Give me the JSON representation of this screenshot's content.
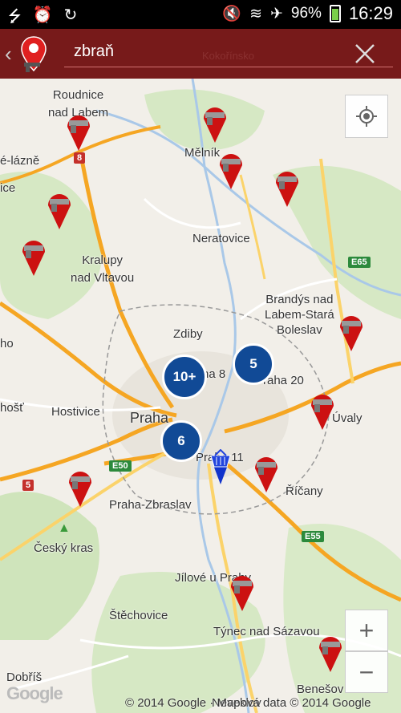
{
  "status_bar": {
    "icons_left": [
      "usb-icon",
      "alarm-icon",
      "sync-icon"
    ],
    "icons_right": [
      "mute-icon",
      "wifi-icon",
      "airplane-icon",
      "battery-icon"
    ],
    "battery": "96%",
    "time": "16:29"
  },
  "app_bar": {
    "search_value": "zbraň",
    "back_glyph": "‹",
    "logo_icon": "map-pin-gun-logo"
  },
  "map": {
    "places": {
      "roudnice": "Roudnice\nnad Labem",
      "melnik": "Mělník",
      "kokorinsko": "Kokořínsko",
      "lazne": "é-lázně",
      "ice": "ice",
      "neratovice": "Neratovice",
      "kralupy": "Kralupy\nnad Vltavou",
      "brandys": "Brandýs nad\nLabem-Stará\nBoleslav",
      "zdiby": "Zdiby",
      "ho": "ho",
      "praha8": "ha 8",
      "praha20": "Praha 20",
      "hostivice": "Hostivice",
      "host": "hošť",
      "praha": "Praha",
      "uvaly": "Úvaly",
      "praha11": "Praha 11",
      "ricany": "Říčany",
      "zbraslav": "Praha-Zbraslav",
      "kras": "Český kras",
      "jilove": "Jílové u Prahy",
      "stechovice": "Štěchovice",
      "tynec": "Týnec nad Sázavou",
      "dobris": "Dobříš",
      "benesov": "Benešov",
      "neveklov": "Neveklov"
    },
    "road_shields": {
      "r8": "8",
      "e65": "E65",
      "e50": "E50",
      "r5": "5",
      "e55": "E55"
    },
    "clusters": [
      "10+",
      "5",
      "6"
    ],
    "colors": {
      "accent": "#6e0a0a",
      "cluster": "#114a96",
      "pin": "#cc1111",
      "motorway": "#f5a623",
      "water": "#a9c8e8"
    },
    "controls": {
      "zoom_in": "+",
      "zoom_out": "−",
      "location_icon": "my-location-icon"
    },
    "watermark": "Google",
    "copyright": "© 2014 Google · Mapová data © 2014 Google"
  }
}
